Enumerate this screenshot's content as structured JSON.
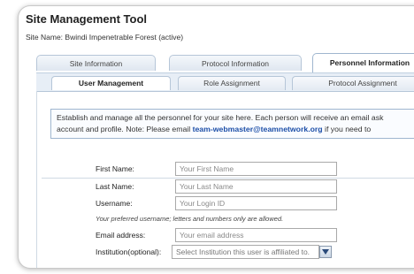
{
  "app": {
    "title": "Site Management Tool",
    "site_name": "Site Name: Bwindi Impenetrable Forest (active)"
  },
  "tabs": [
    {
      "label": "Site Information",
      "active": false
    },
    {
      "label": "Protocol Information",
      "active": false
    },
    {
      "label": "Personnel Information",
      "active": true
    }
  ],
  "subtabs": [
    {
      "label": "User Management",
      "active": true
    },
    {
      "label": "Role Assignment",
      "active": false
    },
    {
      "label": "Protocol Assignment",
      "active": false
    }
  ],
  "info": {
    "line1": "Establish and manage all the personnel for your site here. Each person will receive an email ask",
    "line2_prefix": "account and profile. Note: Please email ",
    "email": "team-webmaster@teamnetwork.org",
    "line2_suffix": " if you need to"
  },
  "form": {
    "first_name": {
      "label": "First Name:",
      "placeholder": "Your First Name",
      "value": ""
    },
    "last_name": {
      "label": "Last Name:",
      "placeholder": "Your Last Name",
      "value": ""
    },
    "username": {
      "label": "Username:",
      "placeholder": "Your Login ID",
      "value": ""
    },
    "username_hint": "Your preferred username; letters and numbers only are allowed.",
    "email": {
      "label": "Email address:",
      "placeholder": "Your email address",
      "value": ""
    },
    "institution": {
      "label": "Institution(optional):",
      "selected": "Select Institution this user is affiliated to."
    }
  },
  "colors": {
    "tab_border": "#b6c6d8",
    "subbar_bg": "#e7eef6",
    "email_link": "#1d4fa8"
  }
}
